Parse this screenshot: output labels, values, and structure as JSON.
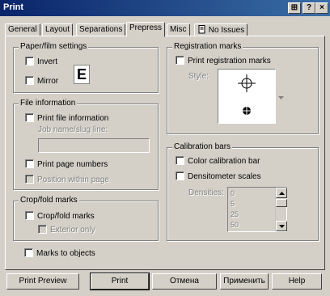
{
  "window": {
    "title": "Print",
    "controls": {
      "context_help": "?",
      "close": "×",
      "extra": "⊞"
    }
  },
  "tabs": [
    {
      "label": "General"
    },
    {
      "label": "Layout"
    },
    {
      "label": "Separations"
    },
    {
      "label": "Prepress",
      "active": true
    },
    {
      "label": "Misc"
    },
    {
      "label": "No Issues"
    }
  ],
  "paper_film": {
    "title": "Paper/film settings",
    "invert": {
      "label": "Invert",
      "checked": false
    },
    "mirror": {
      "label": "Mirror",
      "checked": false
    },
    "preview_glyph": "E"
  },
  "file_info": {
    "title": "File information",
    "print_file_info": {
      "label": "Print file information",
      "checked": false
    },
    "job_name_label": "Job name/slug line:",
    "job_name_value": "",
    "print_page_numbers": {
      "label": "Print page numbers",
      "checked": false
    },
    "position_within_page": {
      "label": "Position within page",
      "checked": false,
      "disabled": true
    }
  },
  "crop_fold": {
    "title": "Crop/fold marks",
    "crop_fold_marks": {
      "label": "Crop/fold marks",
      "checked": false
    },
    "exterior_only": {
      "label": "Exterior only",
      "checked": false,
      "disabled": true
    }
  },
  "marks_to_objects": {
    "label": "Marks to objects",
    "checked": false
  },
  "registration": {
    "title": "Registration marks",
    "print_registration": {
      "label": "Print registration marks",
      "checked": false
    },
    "style_label": "Style:"
  },
  "calibration": {
    "title": "Calibration bars",
    "color_calibration": {
      "label": "Color calibration bar",
      "checked": false
    },
    "densitometer": {
      "label": "Densitometer scales",
      "checked": false
    },
    "densities_label": "Densities:",
    "densities": [
      "0",
      "5",
      "25",
      "50"
    ]
  },
  "footer": {
    "print_preview": "Print Preview",
    "print": "Print",
    "cancel": "Отмена",
    "apply": "Применить",
    "help": "Help"
  }
}
